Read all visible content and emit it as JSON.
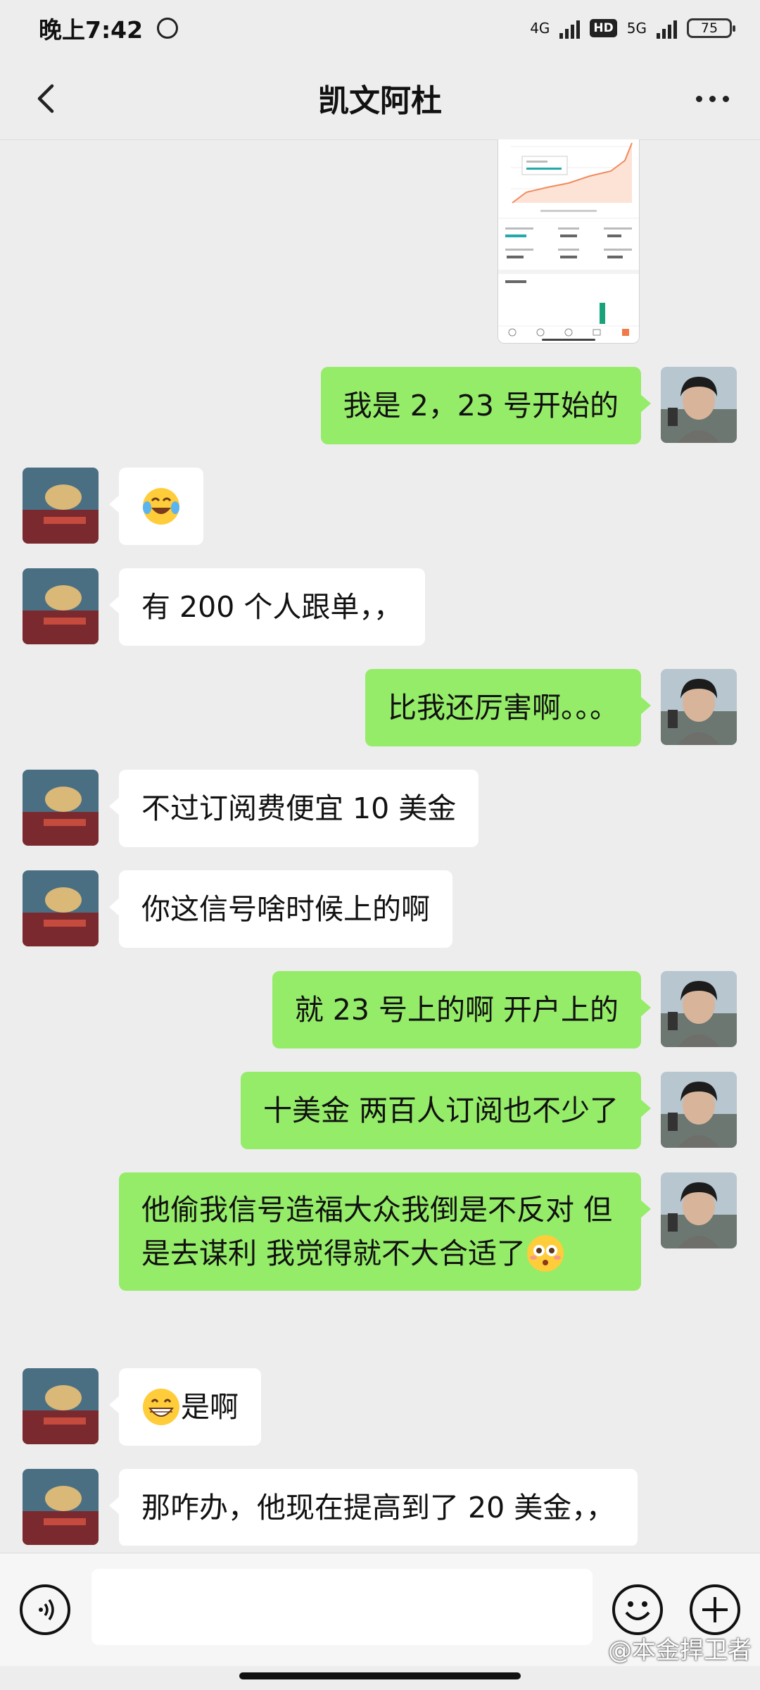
{
  "status_bar": {
    "time": "晚上7:42",
    "network_1": "4G",
    "hd": "HD",
    "network_2": "5G",
    "battery": "75"
  },
  "header": {
    "title": "凯文阿杜"
  },
  "messages": [
    {
      "side": "out",
      "text": "我是 2，23 号开始的"
    },
    {
      "side": "in",
      "text": ""
    },
    {
      "side": "in",
      "text": "有 200 个人跟单，，"
    },
    {
      "side": "out",
      "text": "比我还厉害啊。。。"
    },
    {
      "side": "in",
      "text": "不过订阅费便宜 10 美金"
    },
    {
      "side": "in",
      "text": "你这信号啥时候上的啊"
    },
    {
      "side": "out",
      "text": "就 23 号上的啊  开户上的"
    },
    {
      "side": "out",
      "text": "十美金  两百人订阅也不少了"
    },
    {
      "side": "out",
      "text": "他偷我信号造福大众我倒是不反对  但是去谋利 我觉得就不大合适了"
    },
    {
      "side": "in",
      "text": "是啊"
    },
    {
      "side": "in",
      "text": "那咋办，他现在提高到了 20 美金，，"
    }
  ],
  "emojis": {
    "laugh": "tears-of-joy-emoji",
    "flushed": "flushed-emoji",
    "grin": "grinning-emoji"
  },
  "watermark": "@本金捍卫者",
  "colors": {
    "outgoing_bubble": "#95ec69",
    "incoming_bubble": "#ffffff",
    "background": "#ededed"
  }
}
